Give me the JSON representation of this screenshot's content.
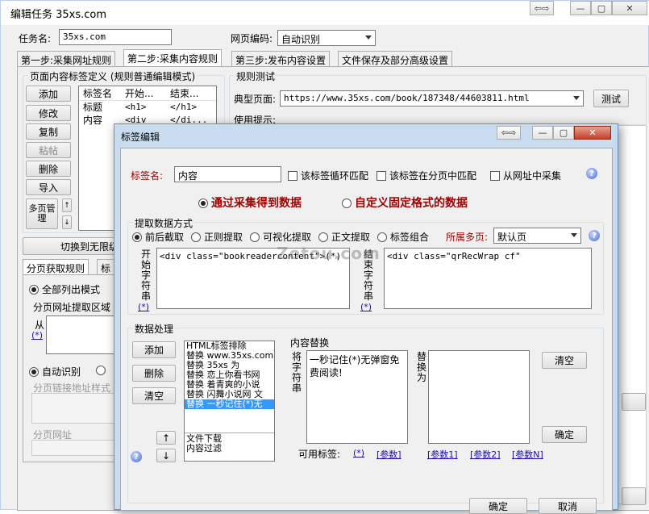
{
  "window": {
    "title": "编辑任务 35xs.com"
  },
  "task": {
    "name_label": "任务名:",
    "name_value": "35xs.com",
    "encoding_label": "网页编码:",
    "encoding_value": "自动识别"
  },
  "tabs": [
    "第一步:采集网址规则",
    "第二步:采集内容规则",
    "第三步:发布内容设置",
    "文件保存及部分高级设置"
  ],
  "left_panel": {
    "group_title": "页面内容标签定义  (规则普通编辑模式)",
    "buttons": {
      "add": "添加",
      "edit": "修改",
      "copy": "复制",
      "paste": "粘帖",
      "delete": "删除",
      "import": "导入",
      "multipage": "多页管理"
    },
    "list_headers": [
      "标签名",
      "开始...",
      "结束..."
    ],
    "rows": [
      [
        "标题",
        "<h1>",
        "</h1>"
      ],
      [
        "内容",
        "<div ...",
        "</di..."
      ]
    ],
    "switch_button": "切换到无限级",
    "sub_tabs": [
      "分页获取规则",
      "标"
    ],
    "all_list_label": "全部列出模式",
    "extract_region_label": "分页网址提取区域",
    "from_label": "从",
    "asterisk_link": "(*)",
    "auto_detect_label": "自动识别",
    "link_style_label": "分页链接地址样式",
    "page_url_label": "分页网址"
  },
  "rule_test": {
    "title": "规则测试",
    "typical_page_label": "典型页面:",
    "typical_page_value": "https://www.35xs.com/book/187348/44603811.html",
    "test_button": "测试",
    "hint_label": "使用提示:"
  },
  "dialog": {
    "title": "标签编辑",
    "tag_name_label": "标签名:",
    "tag_name_value": "内容",
    "checks": [
      "该标签循环匹配",
      "该标签在分页中匹配",
      "从网址中采集"
    ],
    "mode_collect": "通过采集得到数据",
    "mode_fixed": "自定义固定格式的数据",
    "extract_group": "提取数据方式",
    "extract_options": [
      "前后截取",
      "正则提取",
      "可视化提取",
      "正文提取",
      "标签组合"
    ],
    "multipage_label": "所属多页:",
    "multipage_value": "默认页",
    "start_label": "开始字符串",
    "start_value": "<div class=\"bookreadercontent\">(*)",
    "end_label": "结束字符串",
    "end_value": "<div class=\"qrRecWrap cf\"",
    "star": "(*)",
    "data_group": "数据处理",
    "data_buttons": {
      "add": "添加",
      "delete": "删除",
      "clear": "清空"
    },
    "proc_items": [
      "HTML标签排除",
      "替换 www.35xs.com",
      "替换 35xs 为",
      "替换 恋上你看书网",
      "替换 着青爽的小说",
      "替换 闪舞小说网 文",
      "替换 一秒记住(*)无"
    ],
    "proc_items2": [
      "文件下载",
      "内容过滤"
    ],
    "replace_group": "内容替换",
    "replace_from_label": "将字符串",
    "replace_from_value": "一秒记住(*)无弹窗免费阅读!",
    "replace_to_label": "替换为",
    "clear_button": "清空",
    "confirm_button": "确定",
    "available_label": "可用标签:",
    "avail_links": [
      "(*)",
      "[参数]",
      "[参数1]",
      "[参数2]",
      "[参数N]"
    ],
    "ok_button": "确定",
    "cancel_button": "取消"
  },
  "watermark": "Zotou.com",
  "colors": {
    "dialog_title": "#c9dbee",
    "red_label": "#a00000",
    "selected": "#3399ff",
    "link": "#1a0dab"
  }
}
